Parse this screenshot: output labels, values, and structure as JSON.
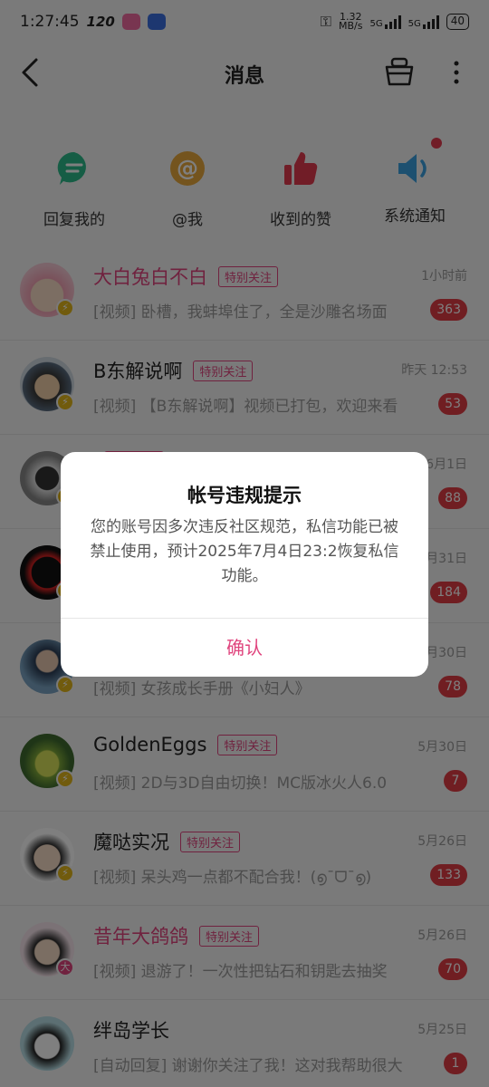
{
  "status_bar": {
    "time": "1:27:45",
    "refresh": "120",
    "net_speed": "1.32",
    "net_unit": "MB/s",
    "sig1": "5G",
    "sig2": "5G",
    "battery": "40"
  },
  "header": {
    "title": "消息"
  },
  "quick": [
    {
      "label": "回复我的",
      "icon": "reply-bubble-icon",
      "color": "#2dbb8a"
    },
    {
      "label": "@我",
      "icon": "at-icon",
      "color": "#e8a93c"
    },
    {
      "label": "收到的赞",
      "icon": "thumbs-up-icon",
      "color": "#e23a4e"
    },
    {
      "label": "系统通知",
      "icon": "speaker-icon",
      "color": "#3aa0e0"
    }
  ],
  "follow_tag": "特别关注",
  "messages": [
    {
      "name": "大白兔白不白",
      "time": "1小时前",
      "preview": "[视频] 卧槽，我蚌埠住了，全是沙雕名场面",
      "count": "363"
    },
    {
      "name": "B东解说啊",
      "time": "昨天 12:53",
      "preview": "[视频] 【B东解说啊】视频已打包，欢迎来看",
      "count": "53"
    },
    {
      "name": "",
      "time": "6月1日",
      "preview": "",
      "count": "88"
    },
    {
      "name": "",
      "time": "5月31日",
      "preview": "",
      "count": "184"
    },
    {
      "name": "",
      "time": "5月30日",
      "preview": "[视频] 女孩成长手册《小妇人》",
      "count": "78"
    },
    {
      "name": "GoldenEggs",
      "time": "5月30日",
      "preview": "[视频] 2D与3D自由切换！MC版冰火人6.0",
      "count": "7"
    },
    {
      "name": "魔哒实况",
      "time": "5月26日",
      "preview": "[视频] 呆头鸡一点都不配合我！(൭¯ᗜ¯൭)",
      "count": "133"
    },
    {
      "name": "昔年大鸽鸽",
      "time": "5月26日",
      "preview": "[视频] 退游了！一次性把钻石和钥匙去抽奖",
      "count": "70"
    },
    {
      "name": "绊岛学长",
      "time": "5月25日",
      "preview": "[自动回复] 谢谢你关注了我！这对我帮助很大",
      "count": "1"
    }
  ],
  "dialog": {
    "title": "帐号违规提示",
    "body": "您的账号因多次违反社区规范，私信功能已被禁止使用，预计2025年7月4日23:2恢复私信功能。",
    "confirm": "确认"
  }
}
